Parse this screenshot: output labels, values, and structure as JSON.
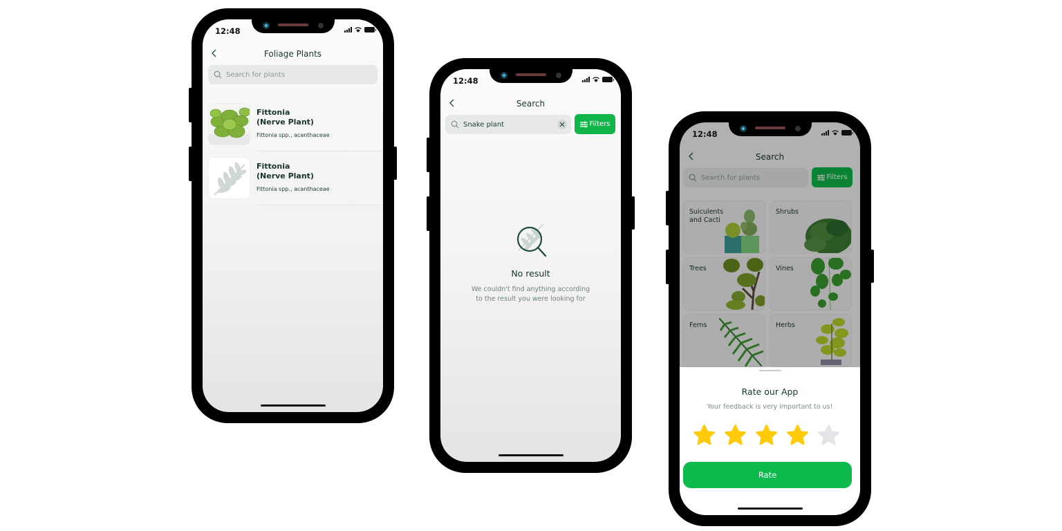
{
  "status_bar": {
    "time": "12:48"
  },
  "screens": {
    "foliage": {
      "title": "Foliage Plants",
      "back_icon": "chevron-left-icon",
      "search": {
        "placeholder": "Search for plants",
        "icon": "search-icon"
      },
      "items": [
        {
          "name_line1": "Fittonia",
          "name_line2": "(Nerve Plant)",
          "scientific": "Fittonia spp., acanthaceae",
          "image": "fittonia-photo"
        },
        {
          "name_line1": "Fittonia",
          "name_line2": "(Nerve Plant)",
          "scientific": "Fittonia spp., acanthaceae",
          "image": "leaf-placeholder-icon"
        }
      ]
    },
    "search_empty": {
      "title": "Search",
      "search": {
        "value": "Snake plant",
        "icon": "search-icon",
        "clear_icon": "close-icon"
      },
      "filters_label": "Filters",
      "empty": {
        "icon": "search-leaf-icon",
        "heading": "No result",
        "message_line1": "We couldn't find anything according",
        "message_line2": "to the result you were looking for"
      }
    },
    "search_rate": {
      "title": "Search",
      "search": {
        "placeholder": "Search for plants",
        "icon": "search-icon"
      },
      "filters_label": "Filters",
      "categories": [
        {
          "label": "Suiculents and Cacti"
        },
        {
          "label": "Shrubs"
        },
        {
          "label": "Trees"
        },
        {
          "label": "Vines"
        },
        {
          "label": "Ferns"
        },
        {
          "label": "Herbs"
        }
      ],
      "rate_sheet": {
        "heading": "Rate our App",
        "subtitle": "Your feedback is very important to us!",
        "rating": 4,
        "max_rating": 5,
        "button_label": "Rate"
      }
    }
  },
  "colors": {
    "accent_green": "#10b64a",
    "text_dark": "#17352c",
    "star_filled": "#ffca0a",
    "star_empty": "#e3e4e8"
  }
}
